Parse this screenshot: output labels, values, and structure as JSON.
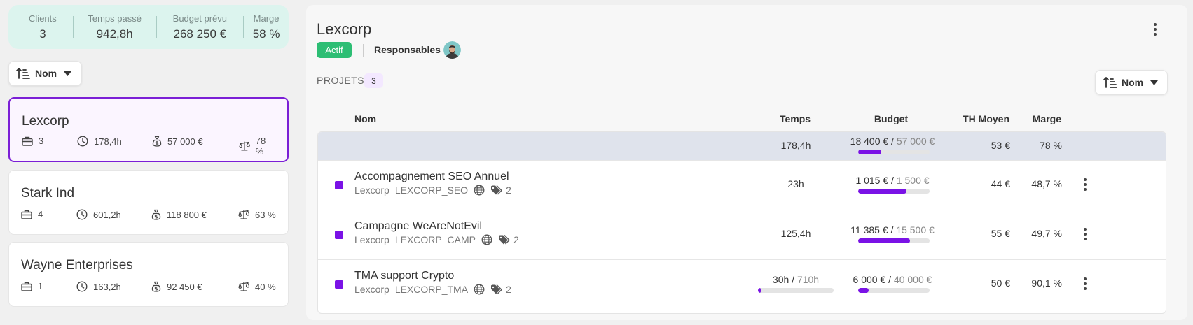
{
  "summary": {
    "clients_label": "Clients",
    "clients_value": "3",
    "time_label": "Temps passé",
    "time_value": "942,8h",
    "budget_label": "Budget prévu",
    "budget_value": "268 250 €",
    "margin_label": "Marge",
    "margin_value": "58 %"
  },
  "left_sort": {
    "label": "Nom"
  },
  "clients": [
    {
      "name": "Lexcorp",
      "projects": "3",
      "time": "178,4h",
      "budget": "57 000 €",
      "margin": "78 %"
    },
    {
      "name": "Stark Ind",
      "projects": "4",
      "time": "601,2h",
      "budget": "118 800 €",
      "margin": "63 %"
    },
    {
      "name": "Wayne Enterprises",
      "projects": "1",
      "time": "163,2h",
      "budget": "92 450 €",
      "margin": "40 %"
    }
  ],
  "detail": {
    "title": "Lexcorp",
    "status": "Actif",
    "responsables_label": "Responsables",
    "projects_label": "PROJETS",
    "projects_count": "3",
    "sort_label": "Nom",
    "columns": {
      "name": "Nom",
      "time": "Temps",
      "budget": "Budget",
      "th": "TH Moyen",
      "margin": "Marge"
    },
    "totals": {
      "time": "178,4h",
      "budget_spent": "18 400 €",
      "budget_sep": "/",
      "budget_total": "57 000 €",
      "budget_progress": 0.32,
      "th": "53 €",
      "margin": "78 %"
    },
    "projects": [
      {
        "name": "Accompagnement SEO Annuel",
        "client": "Lexcorp",
        "code": "LEXCORP_SEO",
        "tags": "2",
        "time": "23h",
        "time_planned": "",
        "time_sep": "",
        "time_progress": null,
        "budget_spent": "1 015 €",
        "budget_sep": "/",
        "budget_total": "1 500 €",
        "budget_progress": 0.68,
        "th": "44 €",
        "margin": "48,7 %"
      },
      {
        "name": "Campagne WeAreNotEvil",
        "client": "Lexcorp",
        "code": "LEXCORP_CAMP",
        "tags": "2",
        "time": "125,4h",
        "time_planned": "",
        "time_sep": "",
        "time_progress": null,
        "budget_spent": "11 385 €",
        "budget_sep": "/",
        "budget_total": "15 500 €",
        "budget_progress": 0.73,
        "th": "55 €",
        "margin": "49,7 %"
      },
      {
        "name": "TMA support Crypto",
        "client": "Lexcorp",
        "code": "LEXCORP_TMA",
        "tags": "2",
        "time": "30h",
        "time_planned": "710h",
        "time_sep": "/",
        "time_progress": 0.04,
        "budget_spent": "6 000 €",
        "budget_sep": "/",
        "budget_total": "40 000 €",
        "budget_progress": 0.15,
        "th": "50 €",
        "margin": "90,1 %"
      }
    ]
  },
  "colors": {
    "accent": "#7a12e6",
    "active_badge": "#2dbe74",
    "summary_bg": "#dcf4ee",
    "selected_border": "#7b1fd6"
  },
  "icons": [
    "sort-icon",
    "chevron-down-icon",
    "briefcase-icon",
    "clock-icon",
    "money-bag-icon",
    "balance-icon",
    "more-vertical-icon",
    "globe-icon",
    "tags-icon"
  ]
}
